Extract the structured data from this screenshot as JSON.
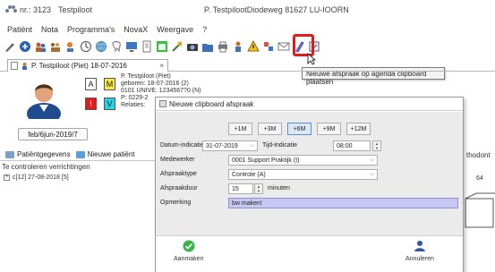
{
  "titlebar": {
    "patient_id": "nr.: 3123",
    "patient_name": "Testpiloot",
    "center_text": "P. TestpilootDiodeweg 81627 LU-IOORN"
  },
  "menu": [
    "Patiënt",
    "Nota",
    "Programma's",
    "NovaX",
    "Weergave",
    "?"
  ],
  "tooltip": "Nieuwe afspraak op agenda clipboard plaatsen",
  "tab": {
    "label": "P. Testpiloot (Piet) 18-07-2016",
    "close": "×"
  },
  "patient": {
    "badges": [
      "A",
      "M",
      "!",
      "V"
    ],
    "info_lines": [
      "P. Testpiloot (Piet)",
      "geboren: 18-07-2016 (2)",
      "0101 UNIVE. 1234567?0 (N)",
      "P: 0229-2",
      "Relaties:"
    ],
    "dob_button": "feb/6jun-2019/7"
  },
  "subtabs": [
    "Patiëntgegevens",
    "Nieuwe patiënt"
  ],
  "controls": {
    "title": "Te controleren verrichtingen",
    "item": "c[12] 27-08-2018 [5]"
  },
  "right_edge": {
    "label": "thodont",
    "number": "64"
  },
  "dialog": {
    "title": "Nieuwe clipboard afspraak",
    "period_buttons": [
      "+1M",
      "+3M",
      "+6M",
      "+9M",
      "+12M"
    ],
    "active_period": "+6M",
    "labels": {
      "date": "Datum-indicatie",
      "time": "Tijd-indicatie",
      "employee": "Medewerker",
      "type": "Afspraaktype",
      "duration": "Afspraakduur",
      "minutes": "minuten",
      "remark": "Opmerking"
    },
    "values": {
      "date": "31-07-2019",
      "time": "08:00",
      "employee": "0001 Support Praktijk (t)",
      "type": "Controle (A)",
      "duration": "15",
      "remark": "bw maken!"
    },
    "ok_label": "Aanmaken",
    "cancel_label": "Annuleren"
  },
  "colors": {
    "highlight_frame": "#e21b1b",
    "remark_bg": "#c7c8f2",
    "active_period": "#dbe8f7"
  },
  "icons": [
    "paw-icon",
    "patient-avatar-icon",
    "checkmark-icon",
    "cancel-person-icon",
    "clipboard-appointment-icon"
  ]
}
